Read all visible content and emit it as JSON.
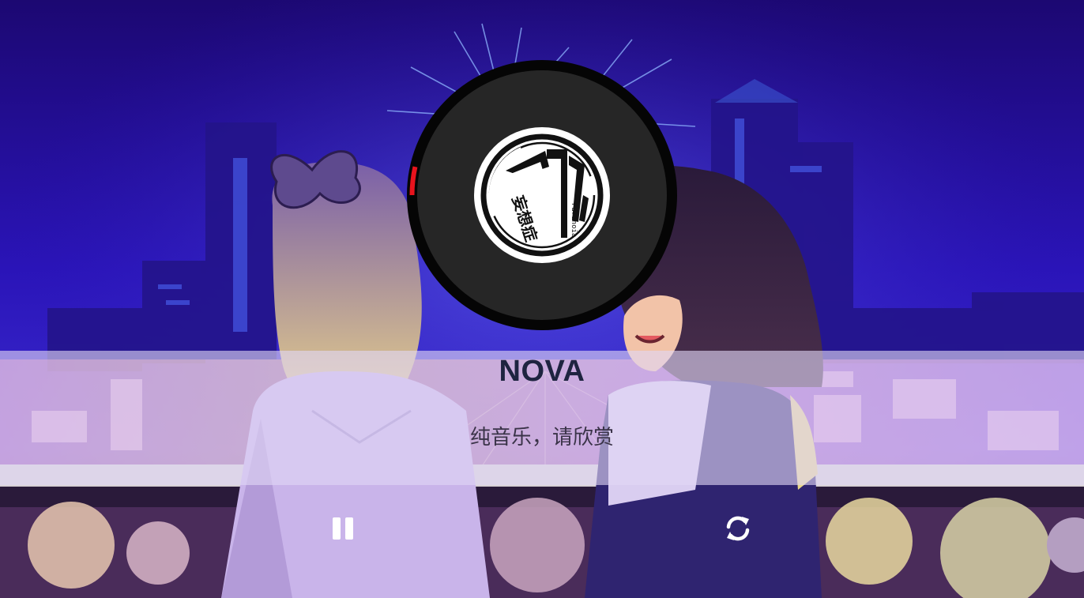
{
  "player": {
    "song_title": "NOVA",
    "lyric": "纯音乐，请欣赏",
    "progress": 0.035,
    "state": "playing",
    "accent_color": "#e8131d"
  },
  "album_art": {
    "text_main": "妄想症",
    "text_sub": "Paranoia"
  },
  "controls": {
    "pause_icon": "pause-icon",
    "repeat_icon": "repeat-icon"
  },
  "colors": {
    "background": "#1a0a6e",
    "disc": "#262626",
    "disc_rim": "#050505",
    "band": "#e1d7f5",
    "title": "#1e2440"
  }
}
